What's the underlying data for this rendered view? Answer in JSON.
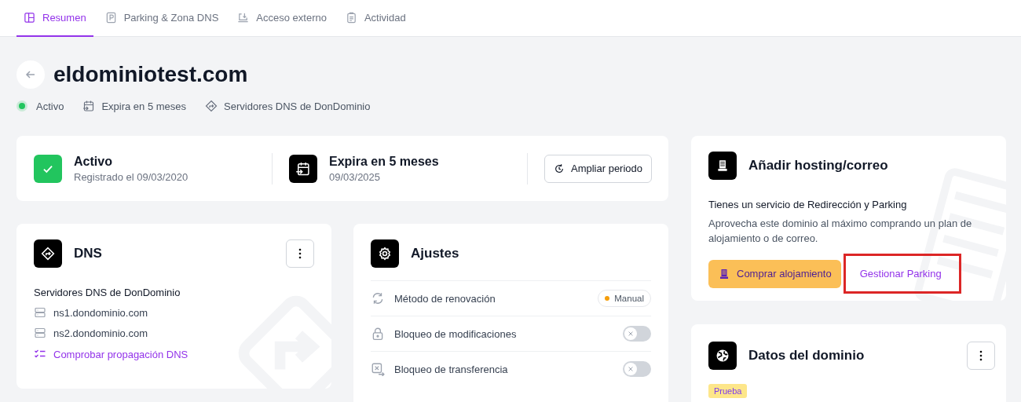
{
  "tabs": [
    {
      "label": "Resumen",
      "selected": true
    },
    {
      "label": "Parking & Zona DNS",
      "selected": false
    },
    {
      "label": "Acceso externo",
      "selected": false
    },
    {
      "label": "Actividad",
      "selected": false
    }
  ],
  "domain": {
    "title": "eldominiotest.com",
    "status": "Activo",
    "expiry": "Expira en 5 meses",
    "dns": "Servidores DNS de DonDominio"
  },
  "summary": {
    "status_title": "Activo",
    "status_sub": "Registrado el 09/03/2020",
    "expiry_title": "Expira en 5 meses",
    "expiry_sub": "09/03/2025",
    "extend_button": "Ampliar periodo"
  },
  "dns_card": {
    "title": "DNS",
    "subtitle": "Servidores DNS de DonDominio",
    "servers": [
      "ns1.dondominio.com",
      "ns2.dondominio.com"
    ],
    "check_link": "Comprobar propagación DNS"
  },
  "settings_card": {
    "title": "Ajustes",
    "rows": [
      {
        "kind": "badge",
        "label": "Método de renovación",
        "badge": "Manual",
        "color": "#f59e0b"
      },
      {
        "kind": "toggle",
        "label": "Bloqueo de modificaciones",
        "on": false
      },
      {
        "kind": "toggle",
        "label": "Bloqueo de transferencia",
        "on": false
      }
    ]
  },
  "hosting_card": {
    "title": "Añadir hosting/correo",
    "heading": "Tienes un servicio de Redirección y Parking",
    "text": "Aprovecha este dominio al máximo comprando un plan de alojamiento o de correo.",
    "buy_button": "Comprar alojamiento",
    "manage_link": "Gestionar Parking",
    "manage_highlighted": true
  },
  "data_card": {
    "title": "Datos del dominio",
    "tag": "Prueba"
  }
}
